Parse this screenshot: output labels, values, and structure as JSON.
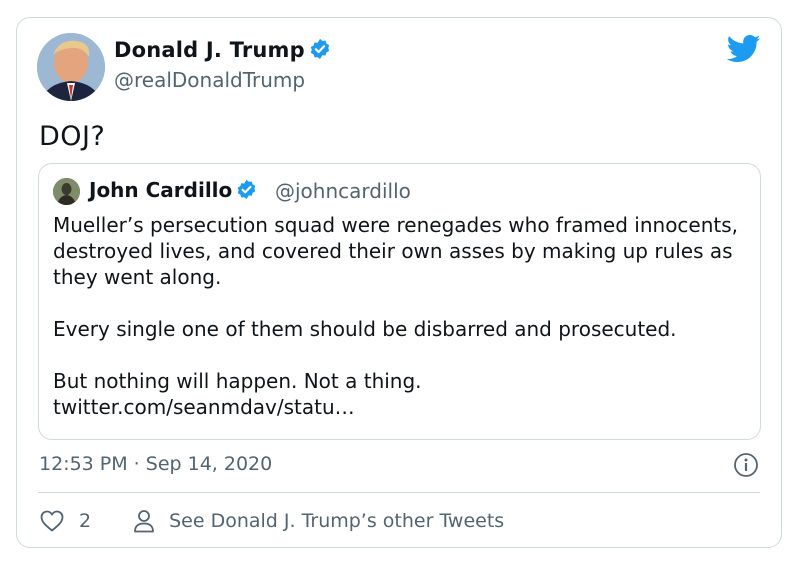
{
  "author": {
    "name": "Donald J. Trump",
    "handle": "@realDonaldTrump",
    "verified": true
  },
  "tweet_text": "DOJ?",
  "quoted_tweet": {
    "name": "John Cardillo",
    "handle": "@johncardillo",
    "verified": true,
    "lines": [
      "Mueller’s persecution squad were renegades who framed innocents, destroyed lives, and covered their own asses by making up rules as they went along.",
      "Every single one of them should be disbarred and prosecuted.",
      "But nothing will happen. Not a thing.",
      "twitter.com/seanmdav/statu…"
    ]
  },
  "timestamp": "12:53 PM · Sep 14, 2020",
  "likes": "2",
  "other_tweets_label": "See Donald J. Trump’s other Tweets",
  "colors": {
    "twitter_blue": "#1d9bf0",
    "secondary_text": "#536471",
    "border": "#cfd9de"
  },
  "icons": [
    "twitter-bird-icon",
    "verified-badge-icon",
    "info-icon",
    "heart-icon",
    "person-icon"
  ]
}
